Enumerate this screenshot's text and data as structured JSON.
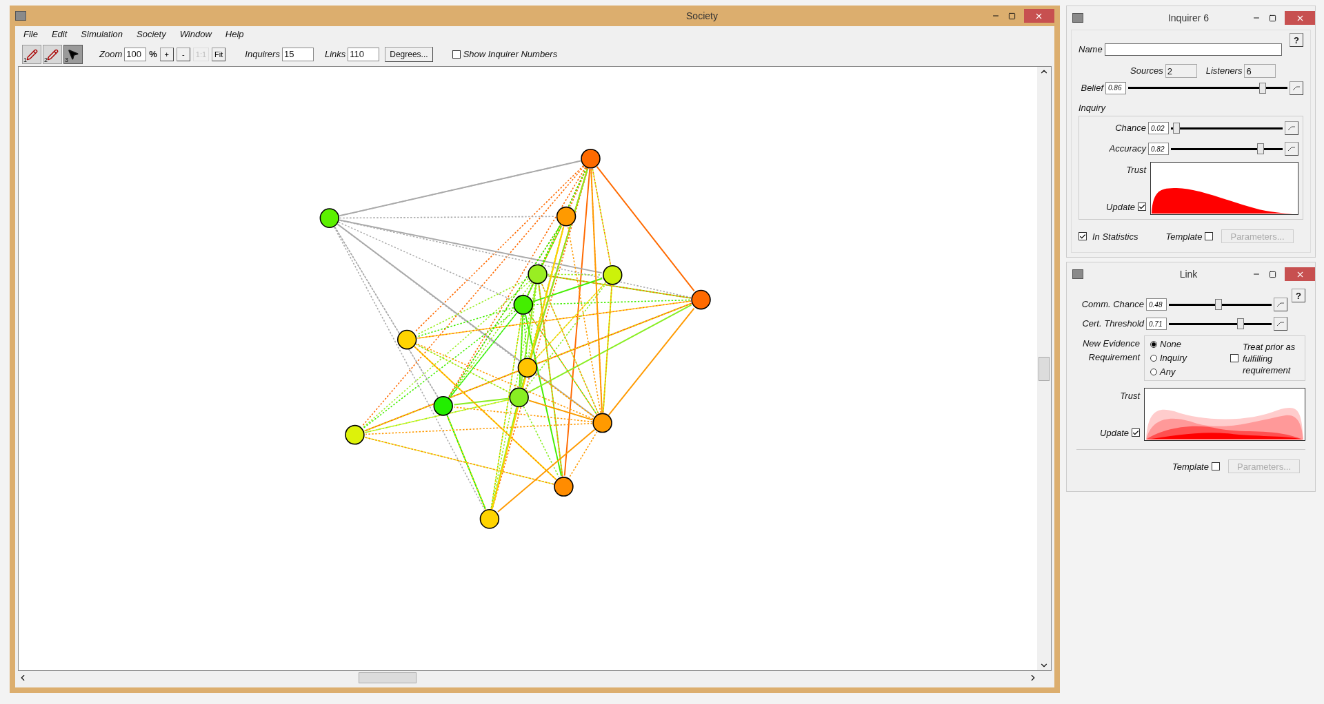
{
  "society_window": {
    "title": "Society",
    "menu": [
      "File",
      "Edit",
      "Simulation",
      "Society",
      "Window",
      "Help"
    ],
    "toolbar": {
      "tools": [
        {
          "number": "1",
          "selected": false
        },
        {
          "number": "2",
          "selected": false
        },
        {
          "number": "3",
          "selected": true
        }
      ],
      "zoom_label": "Zoom",
      "zoom_value": "100",
      "percent": "%",
      "zoom_buttons": [
        {
          "label": "+",
          "disabled": false
        },
        {
          "label": "-",
          "disabled": false
        },
        {
          "label": "1:1",
          "disabled": true
        },
        {
          "label": "Fit",
          "disabled": false
        }
      ],
      "inquirers_label": "Inquirers",
      "inquirers_value": "15",
      "links_label": "Links",
      "links_value": "110",
      "degrees_button": "Degrees...",
      "show_numbers": {
        "label": "Show Inquirer Numbers",
        "checked": false
      }
    },
    "nodes": [
      {
        "color": "#ff6a00"
      },
      {
        "color": "#5cf000"
      },
      {
        "color": "#ff9a00"
      },
      {
        "color": "#99ee22"
      },
      {
        "color": "#ccf20a"
      },
      {
        "color": "#ff6a00"
      },
      {
        "color": "#44ee00"
      },
      {
        "color": "#ffd400"
      },
      {
        "color": "#ffc400"
      },
      {
        "color": "#88ee22"
      },
      {
        "color": "#22ee00"
      },
      {
        "color": "#ddf20a"
      },
      {
        "color": "#ff9a00"
      },
      {
        "color": "#ff8c00"
      },
      {
        "color": "#ffd400"
      }
    ]
  },
  "inquirer_window": {
    "title": "Inquirer 6",
    "help": "?",
    "name_label": "Name",
    "sources_label": "Sources",
    "sources_value": "2",
    "listeners_label": "Listeners",
    "listeners_value": "6",
    "belief": {
      "label": "Belief",
      "reading": "0.86",
      "level": 0.86
    },
    "inquiry_label": "Inquiry",
    "sliders": [
      {
        "label": "Chance",
        "reading": "0.02",
        "level": 0.02
      },
      {
        "label": "Accuracy",
        "reading": "0.82",
        "level": 0.82
      }
    ],
    "trust_label": "Trust",
    "update": {
      "label": "Update",
      "checked": true
    },
    "in_statistics": {
      "label": "In Statistics",
      "checked": true
    },
    "template": {
      "label": "Template",
      "checked": false
    },
    "parameters_button": {
      "label": "Parameters...",
      "disabled": true
    }
  },
  "link_window": {
    "title": "Link",
    "help": "?",
    "sliders": [
      {
        "label": "Comm. Chance",
        "reading": "0.48",
        "level": 0.48
      },
      {
        "label": "Cert. Threshold",
        "reading": "0.71",
        "level": 0.71
      }
    ],
    "requirement_label": "New Evidence Requirement",
    "options": [
      {
        "label": "None",
        "selected": true
      },
      {
        "label": "Inquiry",
        "selected": false
      },
      {
        "label": "Any",
        "selected": false
      }
    ],
    "treat_prior": {
      "label": "Treat prior as fulfilling requirement",
      "checked": false
    },
    "trust_label": "Trust",
    "update": {
      "label": "Update",
      "checked": true
    },
    "template": {
      "label": "Template",
      "checked": false
    },
    "parameters_button": {
      "label": "Parameters...",
      "disabled": true
    }
  }
}
